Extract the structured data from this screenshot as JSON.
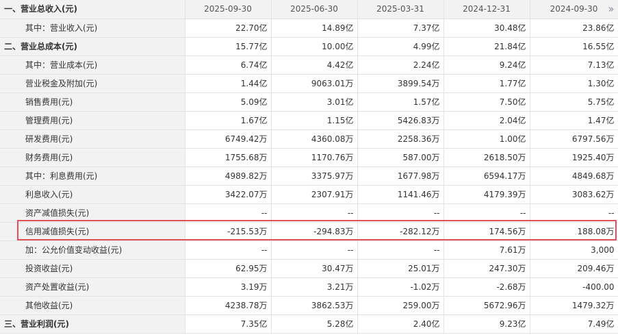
{
  "header": {
    "title": "一、营业总收入(元)",
    "dates": [
      "2025-09-30",
      "2025-06-30",
      "2025-03-31",
      "2024-12-31",
      "2024-09-30"
    ],
    "more_icon": "double-chevron-right-icon"
  },
  "rows": [
    {
      "label": "其中：营业收入(元)",
      "type": "sub",
      "values": [
        "22.70亿",
        "14.89亿",
        "7.37亿",
        "30.48亿",
        "23.86亿"
      ]
    },
    {
      "label": "二、营业总成本(元)",
      "type": "section",
      "values": [
        "15.77亿",
        "10.00亿",
        "4.99亿",
        "21.84亿",
        "16.55亿"
      ]
    },
    {
      "label": "其中：营业成本(元)",
      "type": "sub",
      "values": [
        "6.74亿",
        "4.42亿",
        "2.24亿",
        "9.24亿",
        "7.13亿"
      ]
    },
    {
      "label": "营业税金及附加(元)",
      "type": "sub",
      "values": [
        "1.44亿",
        "9063.01万",
        "3899.54万",
        "1.77亿",
        "1.30亿"
      ]
    },
    {
      "label": "销售费用(元)",
      "type": "sub",
      "values": [
        "5.09亿",
        "3.01亿",
        "1.57亿",
        "7.50亿",
        "5.75亿"
      ]
    },
    {
      "label": "管理费用(元)",
      "type": "sub",
      "values": [
        "1.67亿",
        "1.15亿",
        "5426.83万",
        "2.04亿",
        "1.47亿"
      ]
    },
    {
      "label": "研发费用(元)",
      "type": "sub",
      "values": [
        "6749.42万",
        "4360.08万",
        "2258.36万",
        "1.00亿",
        "6797.56万"
      ]
    },
    {
      "label": "财务费用(元)",
      "type": "sub",
      "values": [
        "1755.68万",
        "1170.76万",
        "587.00万",
        "2618.50万",
        "1925.40万"
      ]
    },
    {
      "label": "其中：利息费用(元)",
      "type": "sub",
      "values": [
        "4989.82万",
        "3375.97万",
        "1677.98万",
        "6594.17万",
        "4849.68万"
      ]
    },
    {
      "label": "利息收入(元)",
      "type": "sub",
      "values": [
        "3422.07万",
        "2307.91万",
        "1141.46万",
        "4179.39万",
        "3083.62万"
      ]
    },
    {
      "label": "资产减值损失(元)",
      "type": "sub",
      "values": [
        "--",
        "--",
        "--",
        "--",
        "--"
      ]
    },
    {
      "label": "信用减值损失(元)",
      "type": "sub",
      "values": [
        "-215.53万",
        "-294.83万",
        "-282.12万",
        "174.56万",
        "188.08万"
      ]
    },
    {
      "label": "加：公允价值变动收益(元)",
      "type": "sub",
      "values": [
        "--",
        "--",
        "--",
        "7.61万",
        "3,000"
      ]
    },
    {
      "label": "投资收益(元)",
      "type": "sub",
      "values": [
        "62.95万",
        "30.47万",
        "25.01万",
        "247.30万",
        "209.46万"
      ]
    },
    {
      "label": "资产处置收益(元)",
      "type": "sub",
      "values": [
        "3.19万",
        "3.21万",
        "-1.02万",
        "-2.68万",
        "-400.00"
      ]
    },
    {
      "label": "其他收益(元)",
      "type": "sub",
      "values": [
        "4238.78万",
        "3862.53万",
        "259.00万",
        "5672.96万",
        "1479.32万"
      ]
    },
    {
      "label": "三、营业利润(元)",
      "type": "section",
      "values": [
        "7.35亿",
        "5.28亿",
        "2.40亿",
        "9.23亿",
        "7.49亿"
      ]
    }
  ],
  "highlight_color": "#e2505a"
}
